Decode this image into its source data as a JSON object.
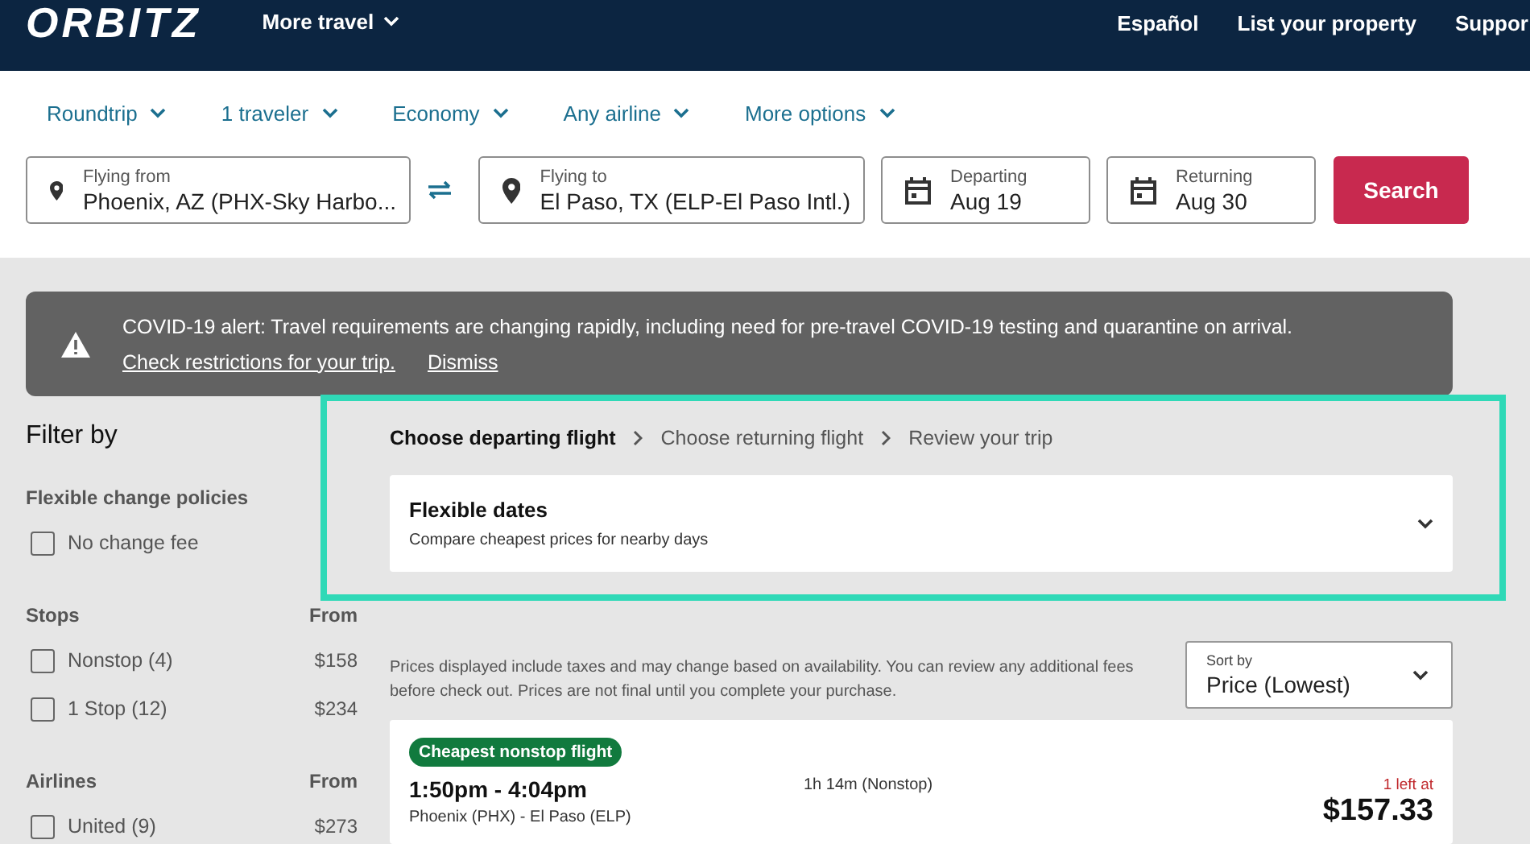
{
  "header": {
    "logo": "ORBITZ",
    "menu": "More travel",
    "links": [
      "Español",
      "List your property",
      "Suppor"
    ]
  },
  "options": [
    "Roundtrip",
    "1 traveler",
    "Economy",
    "Any airline",
    "More options"
  ],
  "search": {
    "from": {
      "label": "Flying from",
      "value": "Phoenix, AZ (PHX-Sky Harbo..."
    },
    "to": {
      "label": "Flying to",
      "value": "El Paso, TX (ELP-El Paso Intl.)"
    },
    "departing": {
      "label": "Departing",
      "value": "Aug 19"
    },
    "returning": {
      "label": "Returning",
      "value": "Aug 30"
    },
    "button": "Search"
  },
  "alert": {
    "text": "COVID-19 alert: Travel requirements are changing rapidly, including need for pre-travel COVID-19 testing and quarantine on arrival.",
    "links": [
      "Check restrictions for your trip.",
      "Dismiss"
    ]
  },
  "filters": {
    "title": "Filter by",
    "groups": [
      {
        "heading": "Flexible change policies",
        "items": [
          {
            "label": "No change fee",
            "checked": false
          }
        ]
      },
      {
        "heading": "Stops",
        "from": "From",
        "items": [
          {
            "label": "Nonstop (4)",
            "price": "$158",
            "checked": false
          },
          {
            "label": "1 Stop (12)",
            "price": "$234",
            "checked": false
          }
        ]
      },
      {
        "heading": "Airlines",
        "from": "From",
        "items": [
          {
            "label": "United (9)",
            "price": "$273",
            "checked": false
          }
        ]
      }
    ]
  },
  "steps": [
    {
      "label": "Choose departing flight",
      "selected": true
    },
    {
      "label": "Choose returning flight",
      "selected": false
    },
    {
      "label": "Review your trip",
      "selected": false
    }
  ],
  "flexible": {
    "title": "Flexible dates",
    "subtitle": "Compare cheapest prices for nearby days",
    "expanded": false
  },
  "disclaimer": "Prices displayed include taxes and may change based on availability. You can review any additional fees before check out. Prices are not final until you complete your purchase.",
  "sort": {
    "label": "Sort by",
    "value": "Price (Lowest)"
  },
  "flight": {
    "badge": "Cheapest nonstop flight",
    "times": "1:50pm - 4:04pm",
    "route": "Phoenix (PHX) - El Paso (ELP)",
    "duration": "1h 14m (Nonstop)",
    "seats": "1 left at",
    "price": "$157.33"
  }
}
